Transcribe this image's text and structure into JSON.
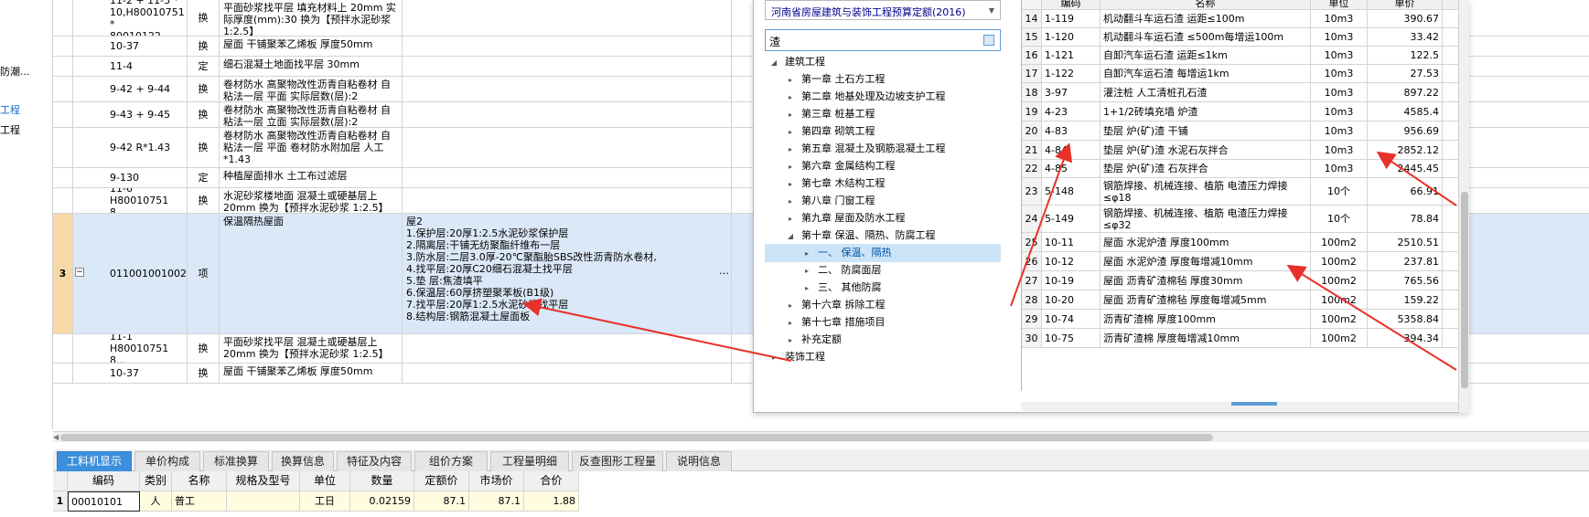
{
  "left_strip": {
    "items": [
      "防潮...",
      "工程",
      "工程"
    ]
  },
  "main_rows": [
    {
      "num": "",
      "code": "11-2 + 11-3 *\n10,H80010751 *\n80010122",
      "type": "换",
      "name": "平面砂浆找平层 填充材料上 20mm 实际厚度(mm):30 换为【预拌水泥砂浆 1:2.5】",
      "feat": ""
    },
    {
      "num": "",
      "code": "10-37",
      "type": "换",
      "name": "屋面 干铺聚苯乙烯板 厚度50mm",
      "feat": ""
    },
    {
      "num": "",
      "code": "11-4",
      "type": "定",
      "name": "细石混凝土地面找平层 30mm",
      "feat": ""
    },
    {
      "num": "",
      "code": "9-42 + 9-44",
      "type": "换",
      "name": "卷材防水 高聚物改性沥青自粘卷材 自粘法一层 平面 实际层数(层):2",
      "feat": ""
    },
    {
      "num": "",
      "code": "9-43 + 9-45",
      "type": "换",
      "name": "卷材防水 高聚物改性沥青自粘卷材 自粘法一层 立面 实际层数(层):2",
      "feat": ""
    },
    {
      "num": "",
      "code": "9-42 R*1.43",
      "type": "换",
      "name": "卷材防水 高聚物改性沥青自粘卷材 自粘法一层 平面 卷材防水附加层 人工*1.43",
      "feat": ""
    },
    {
      "num": "",
      "code": "9-130",
      "type": "定",
      "name": "种植屋面排水 土工布过滤层",
      "feat": ""
    },
    {
      "num": "",
      "code": "11-6\nH80010751 8…",
      "type": "换",
      "name": "水泥砂浆楼地面 混凝土或硬基层上 20mm 换为【预拌水泥砂浆 1:2.5】",
      "feat": ""
    },
    {
      "num": "3",
      "code": "011001001002",
      "type": "项",
      "name": "保温隔热屋面",
      "feat": "屋2\n1.保护层:20厚1:2.5水泥砂浆保护层\n2.隔离层:干铺无纺聚酯纤维布一层\n3.防水层:二层3.0厚-20℃聚酯胎SBS改性沥青防水卷材,\n4.找平层:20厚C20细石混凝土找平层\n5.垫 层:焦渣填平\n6.保温层:60厚挤塑聚苯板(B1级)\n7.找平层:20厚1:2.5水泥砂浆找平层\n8.结构层:钢筋混凝土屋面板"
    },
    {
      "num": "",
      "code": "11-1\nH80010751 8…",
      "type": "换",
      "name": "平面砂浆找平层 混凝土或硬基层上 20mm 换为【预拌水泥砂浆 1:2.5】",
      "feat": ""
    },
    {
      "num": "",
      "code": "10-37",
      "type": "换",
      "name": "屋面 干铺聚苯乙烯板 厚度50mm",
      "feat": ""
    }
  ],
  "dialog": {
    "quota_library": "河南省房屋建筑与装饰工程预算定额(2016)",
    "search_value": "渣",
    "tree": [
      {
        "label": "建筑工程",
        "level": 0,
        "state": "open"
      },
      {
        "label": "第一章 土石方工程",
        "level": 1,
        "state": "closed"
      },
      {
        "label": "第二章 地基处理及边坡支护工程",
        "level": 1,
        "state": "closed"
      },
      {
        "label": "第三章 桩基工程",
        "level": 1,
        "state": "closed"
      },
      {
        "label": "第四章 砌筑工程",
        "level": 1,
        "state": "closed"
      },
      {
        "label": "第五章 混凝土及钢筋混凝土工程",
        "level": 1,
        "state": "closed"
      },
      {
        "label": "第六章 金属结构工程",
        "level": 1,
        "state": "closed"
      },
      {
        "label": "第七章 木结构工程",
        "level": 1,
        "state": "closed"
      },
      {
        "label": "第八章 门窗工程",
        "level": 1,
        "state": "closed"
      },
      {
        "label": "第九章 屋面及防水工程",
        "level": 1,
        "state": "closed"
      },
      {
        "label": "第十章 保温、隔热、防腐工程",
        "level": 1,
        "state": "open"
      },
      {
        "label": "一、 保温、隔热",
        "level": 2,
        "state": "closed",
        "selected": true
      },
      {
        "label": "二、 防腐面层",
        "level": 2,
        "state": "closed"
      },
      {
        "label": "三、 其他防腐",
        "level": 2,
        "state": "closed"
      },
      {
        "label": "第十六章 拆除工程",
        "level": 1,
        "state": "closed"
      },
      {
        "label": "第十七章 措施项目",
        "level": 1,
        "state": "closed"
      },
      {
        "label": "补充定额",
        "level": 1,
        "state": "closed"
      },
      {
        "label": "装饰工程",
        "level": 0,
        "state": "closed"
      }
    ],
    "quota_header": {
      "code": "编码",
      "name": "名称",
      "unit": "单位",
      "price": "单价"
    },
    "quota_rows": [
      {
        "idx": "14",
        "code": "1-119",
        "name": "机动翻斗车运石渣 运距≤100m",
        "unit": "10m3",
        "price": "390.67"
      },
      {
        "idx": "15",
        "code": "1-120",
        "name": "机动翻斗车运石渣 ≤500m每增运100m",
        "unit": "10m3",
        "price": "33.42"
      },
      {
        "idx": "16",
        "code": "1-121",
        "name": "自卸汽车运石渣 运距≤1km",
        "unit": "10m3",
        "price": "122.5"
      },
      {
        "idx": "17",
        "code": "1-122",
        "name": "自卸汽车运石渣 每增运1km",
        "unit": "10m3",
        "price": "27.53"
      },
      {
        "idx": "18",
        "code": "3-97",
        "name": "灌注桩 人工清桩孔石渣",
        "unit": "10m3",
        "price": "897.22"
      },
      {
        "idx": "19",
        "code": "4-23",
        "name": "1+1/2砖填充墙 炉渣",
        "unit": "10m3",
        "price": "4585.4"
      },
      {
        "idx": "20",
        "code": "4-83",
        "name": "垫层 炉(矿)渣 干铺",
        "unit": "10m3",
        "price": "956.69"
      },
      {
        "idx": "21",
        "code": "4-84",
        "name": "垫层 炉(矿)渣 水泥石灰拌合",
        "unit": "10m3",
        "price": "2852.12"
      },
      {
        "idx": "22",
        "code": "4-85",
        "name": "垫层 炉(矿)渣 石灰拌合",
        "unit": "10m3",
        "price": "2445.45"
      },
      {
        "idx": "23",
        "code": "5-148",
        "name": "钢筋焊接、机械连接、植筋 电渣压力焊接 ≤φ18",
        "unit": "10个",
        "price": "66.91"
      },
      {
        "idx": "24",
        "code": "5-149",
        "name": "钢筋焊接、机械连接、植筋 电渣压力焊接 ≤φ32",
        "unit": "10个",
        "price": "78.84"
      },
      {
        "idx": "25",
        "code": "10-11",
        "name": "屋面 水泥炉渣 厚度100mm",
        "unit": "100m2",
        "price": "2510.51"
      },
      {
        "idx": "26",
        "code": "10-12",
        "name": "屋面 水泥炉渣 厚度每增减10mm",
        "unit": "100m2",
        "price": "237.81"
      },
      {
        "idx": "27",
        "code": "10-19",
        "name": "屋面 沥青矿渣棉毡 厚度30mm",
        "unit": "100m2",
        "price": "765.56"
      },
      {
        "idx": "28",
        "code": "10-20",
        "name": "屋面 沥青矿渣棉毡 厚度每增减5mm",
        "unit": "100m2",
        "price": "159.22"
      },
      {
        "idx": "29",
        "code": "10-74",
        "name": "沥青矿渣棉 厚度100mm",
        "unit": "100m2",
        "price": "5358.84"
      },
      {
        "idx": "30",
        "code": "10-75",
        "name": "沥青矿渣棉 厚度每增减10mm",
        "unit": "100m2",
        "price": "394.34"
      }
    ]
  },
  "bottom_tabs": [
    "工料机显示",
    "单价构成",
    "标准换算",
    "换算信息",
    "特征及内容",
    "组价方案",
    "工程量明细",
    "反查图形工程量",
    "说明信息"
  ],
  "bottom_grid": {
    "headers": [
      "编码",
      "类别",
      "名称",
      "规格及型号",
      "单位",
      "数量",
      "定额价",
      "市场价",
      "合价"
    ],
    "rows": [
      [
        "00010101",
        "人",
        "普工",
        "",
        "工日",
        "0.02159",
        "87.1",
        "87.1",
        "1.88"
      ]
    ],
    "row_nums": [
      "1"
    ]
  },
  "colors": {
    "accent": "#3c8fdc",
    "selection": "#dbe8f8",
    "arrow": "#e8312a"
  }
}
